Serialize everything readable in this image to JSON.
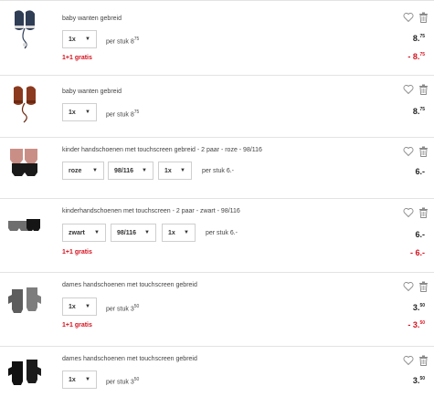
{
  "items": [
    {
      "name": "baby wanten gebreid",
      "qty": "1x",
      "per_stuk": "per stuk 8",
      "per_stuk_cents": "75",
      "gratis": "1+1 gratis",
      "price_main": "8.",
      "price_cents": "75",
      "discount_main": "- 8.",
      "discount_cents": "75"
    },
    {
      "name": "baby wanten gebreid",
      "qty": "1x",
      "per_stuk": "per stuk 8",
      "per_stuk_cents": "75",
      "price_main": "8.",
      "price_cents": "75"
    },
    {
      "name": "kinder handschoenen met touchscreen gebreid - 2 paar - roze - 98/116",
      "color": "roze",
      "size": "98/116",
      "qty": "1x",
      "per_stuk": "per stuk 6.-",
      "price_main": "6.-"
    },
    {
      "name": "kinderhandschoenen met touchscreen - 2 paar - zwart - 98/116",
      "color": "zwart",
      "size": "98/116",
      "qty": "1x",
      "per_stuk": "per stuk 6.-",
      "gratis": "1+1 gratis",
      "price_main": "6.-",
      "discount_main": "- 6.-"
    },
    {
      "name": "dames handschoenen met touchscreen gebreid",
      "qty": "1x",
      "per_stuk": "per stuk 3",
      "per_stuk_cents": "50",
      "gratis": "1+1 gratis",
      "price_main": "3.",
      "price_cents": "50",
      "discount_main": "- 3.",
      "discount_cents": "50"
    },
    {
      "name": "dames handschoenen met touchscreen gebreid",
      "qty": "1x",
      "per_stuk": "per stuk 3",
      "per_stuk_cents": "50",
      "price_main": "3.",
      "price_cents": "50"
    }
  ],
  "icons": {
    "heart": "heart-icon",
    "trash": "trash-icon",
    "chevron": "chevron-down-icon"
  },
  "colors": {
    "accent_red": "#d6111e",
    "text": "#333333",
    "border": "#e3e3e3"
  }
}
